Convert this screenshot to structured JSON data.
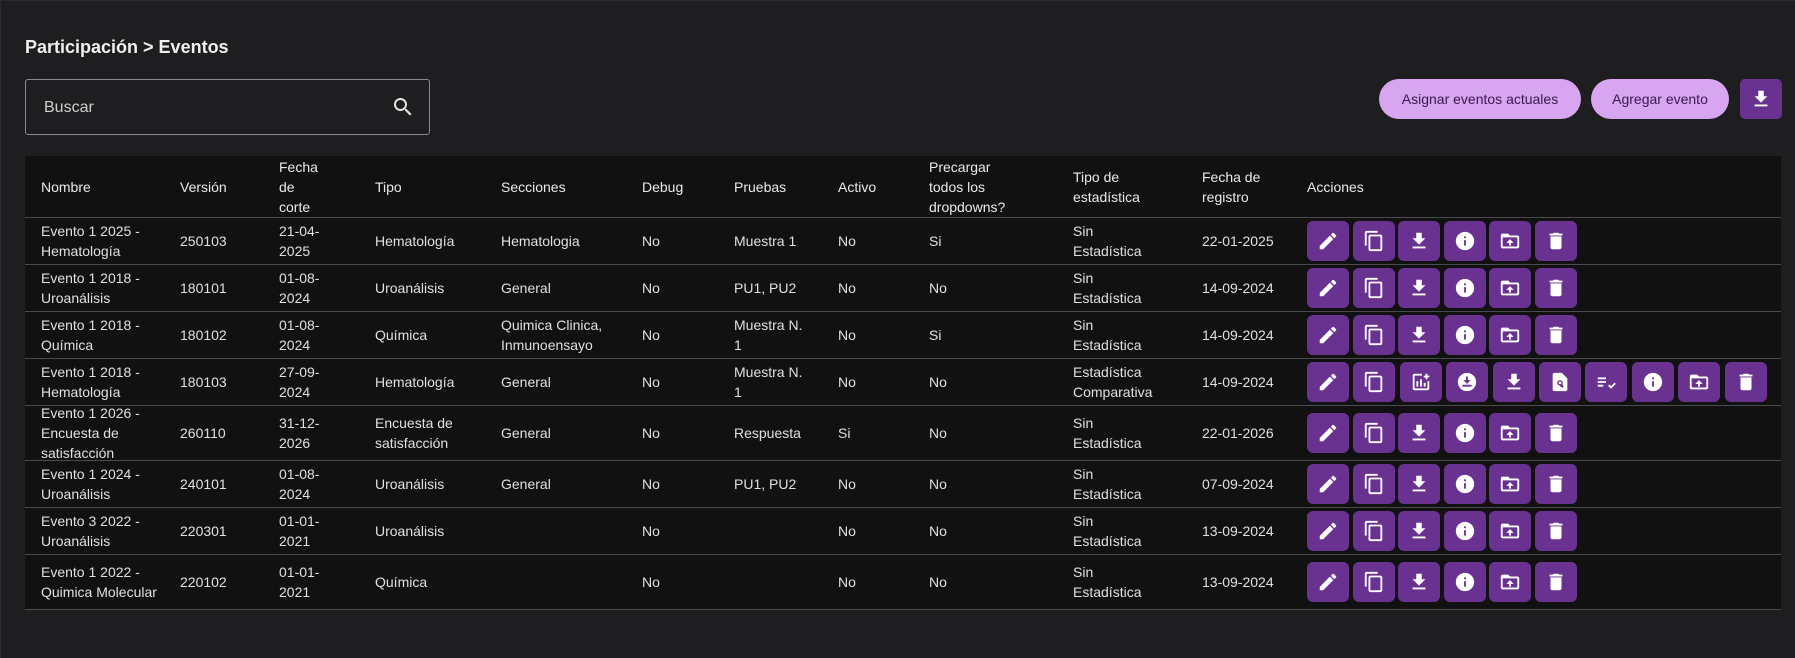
{
  "breadcrumb": "Participación > Eventos",
  "search": {
    "placeholder": "Buscar",
    "value": ""
  },
  "buttons": {
    "assign_label": "Asignar eventos actuales",
    "add_label": "Agregar evento"
  },
  "colors": {
    "accent_pill": "#d8a5f0",
    "action_button": "#6a3290",
    "background": "#1e1e20",
    "table_background": "#111112"
  },
  "table": {
    "headers": {
      "nombre": "Nombre",
      "version": "Versión",
      "fecha_corte": "Fecha de corte",
      "tipo": "Tipo",
      "secciones": "Secciones",
      "debug": "Debug",
      "pruebas": "Pruebas",
      "activo": "Activo",
      "precargar": "Precargar todos los dropdowns?",
      "tipo_estadistica": "Tipo de estadística",
      "fecha_registro": "Fecha de registro",
      "acciones": "Acciones"
    },
    "rows": [
      {
        "nombre": "Evento 1 2025 - Hematología",
        "version": "250103",
        "fecha_corte": "21-04-2025",
        "tipo": "Hematología",
        "secciones": "Hematologia",
        "debug": "No",
        "pruebas": "Muestra 1",
        "activo": "No",
        "precargar": "Si",
        "tipo_estadistica": "Sin Estadística",
        "fecha_registro": "22-01-2025",
        "actions": [
          "edit-icon",
          "copy-icon",
          "download-icon",
          "info-icon",
          "folder-upload-icon",
          "delete-icon"
        ]
      },
      {
        "nombre": "Evento 1 2018 - Uroanálisis",
        "version": "180101",
        "fecha_corte": "01-08-2024",
        "tipo": "Uroanálisis",
        "secciones": "General",
        "debug": "No",
        "pruebas": "PU1, PU2",
        "activo": "No",
        "precargar": "No",
        "tipo_estadistica": "Sin Estadística",
        "fecha_registro": "14-09-2024",
        "actions": [
          "edit-icon",
          "copy-icon",
          "download-icon",
          "info-icon",
          "folder-upload-icon",
          "delete-icon"
        ]
      },
      {
        "nombre": "Evento 1 2018 - Química",
        "version": "180102",
        "fecha_corte": "01-08-2024",
        "tipo": "Química",
        "secciones": "Quimica Clinica, Inmunoensayo",
        "debug": "No",
        "pruebas": "Muestra N. 1",
        "activo": "No",
        "precargar": "Si",
        "tipo_estadistica": "Sin Estadística",
        "fecha_registro": "14-09-2024",
        "actions": [
          "edit-icon",
          "copy-icon",
          "download-icon",
          "info-icon",
          "folder-upload-icon",
          "delete-icon"
        ]
      },
      {
        "nombre": "Evento 1 2018 - Hematología",
        "version": "180103",
        "fecha_corte": "27-09-2024",
        "tipo": "Hematología",
        "secciones": "General",
        "debug": "No",
        "pruebas": "Muestra N. 1",
        "activo": "No",
        "precargar": "No",
        "tipo_estadistica": "Estadística Comparativa",
        "fecha_registro": "14-09-2024",
        "actions": [
          "edit-icon",
          "copy-icon",
          "chart-add-icon",
          "download-circle-icon",
          "download-icon",
          "search-document-icon",
          "checklist-icon",
          "info-icon",
          "folder-upload-icon",
          "delete-icon"
        ]
      },
      {
        "nombre": "Evento 1 2026 - Encuesta de satisfacción",
        "version": "260110",
        "fecha_corte": "31-12-2026",
        "tipo": "Encuesta de satisfacción",
        "secciones": "General",
        "debug": "No",
        "pruebas": "Respuesta",
        "activo": "Si",
        "precargar": "No",
        "tipo_estadistica": "Sin Estadística",
        "fecha_registro": "22-01-2026",
        "actions": [
          "edit-icon",
          "copy-icon",
          "download-icon",
          "info-icon",
          "folder-upload-icon",
          "delete-icon"
        ]
      },
      {
        "nombre": "Evento 1 2024 - Uroanálisis",
        "version": "240101",
        "fecha_corte": "01-08-2024",
        "tipo": "Uroanálisis",
        "secciones": "General",
        "debug": "No",
        "pruebas": "PU1, PU2",
        "activo": "No",
        "precargar": "No",
        "tipo_estadistica": "Sin Estadística",
        "fecha_registro": "07-09-2024",
        "actions": [
          "edit-icon",
          "copy-icon",
          "download-icon",
          "info-icon",
          "folder-upload-icon",
          "delete-icon"
        ]
      },
      {
        "nombre": "Evento 3 2022 - Uroanálisis",
        "version": "220301",
        "fecha_corte": "01-01-2021",
        "tipo": "Uroanálisis",
        "secciones": "",
        "debug": "No",
        "pruebas": "",
        "activo": "No",
        "precargar": "No",
        "tipo_estadistica": "Sin Estadística",
        "fecha_registro": "13-09-2024",
        "actions": [
          "edit-icon",
          "copy-icon",
          "download-icon",
          "info-icon",
          "folder-upload-icon",
          "delete-icon"
        ]
      },
      {
        "nombre": "Evento 1 2022 - Quimica Molecular",
        "version": "220102",
        "fecha_corte": "01-01-2021",
        "tipo": "Química",
        "secciones": "",
        "debug": "No",
        "pruebas": "",
        "activo": "No",
        "precargar": "No",
        "tipo_estadistica": "Sin Estadística",
        "fecha_registro": "13-09-2024",
        "actions": [
          "edit-icon",
          "copy-icon",
          "download-icon",
          "info-icon",
          "folder-upload-icon",
          "delete-icon"
        ]
      }
    ]
  }
}
